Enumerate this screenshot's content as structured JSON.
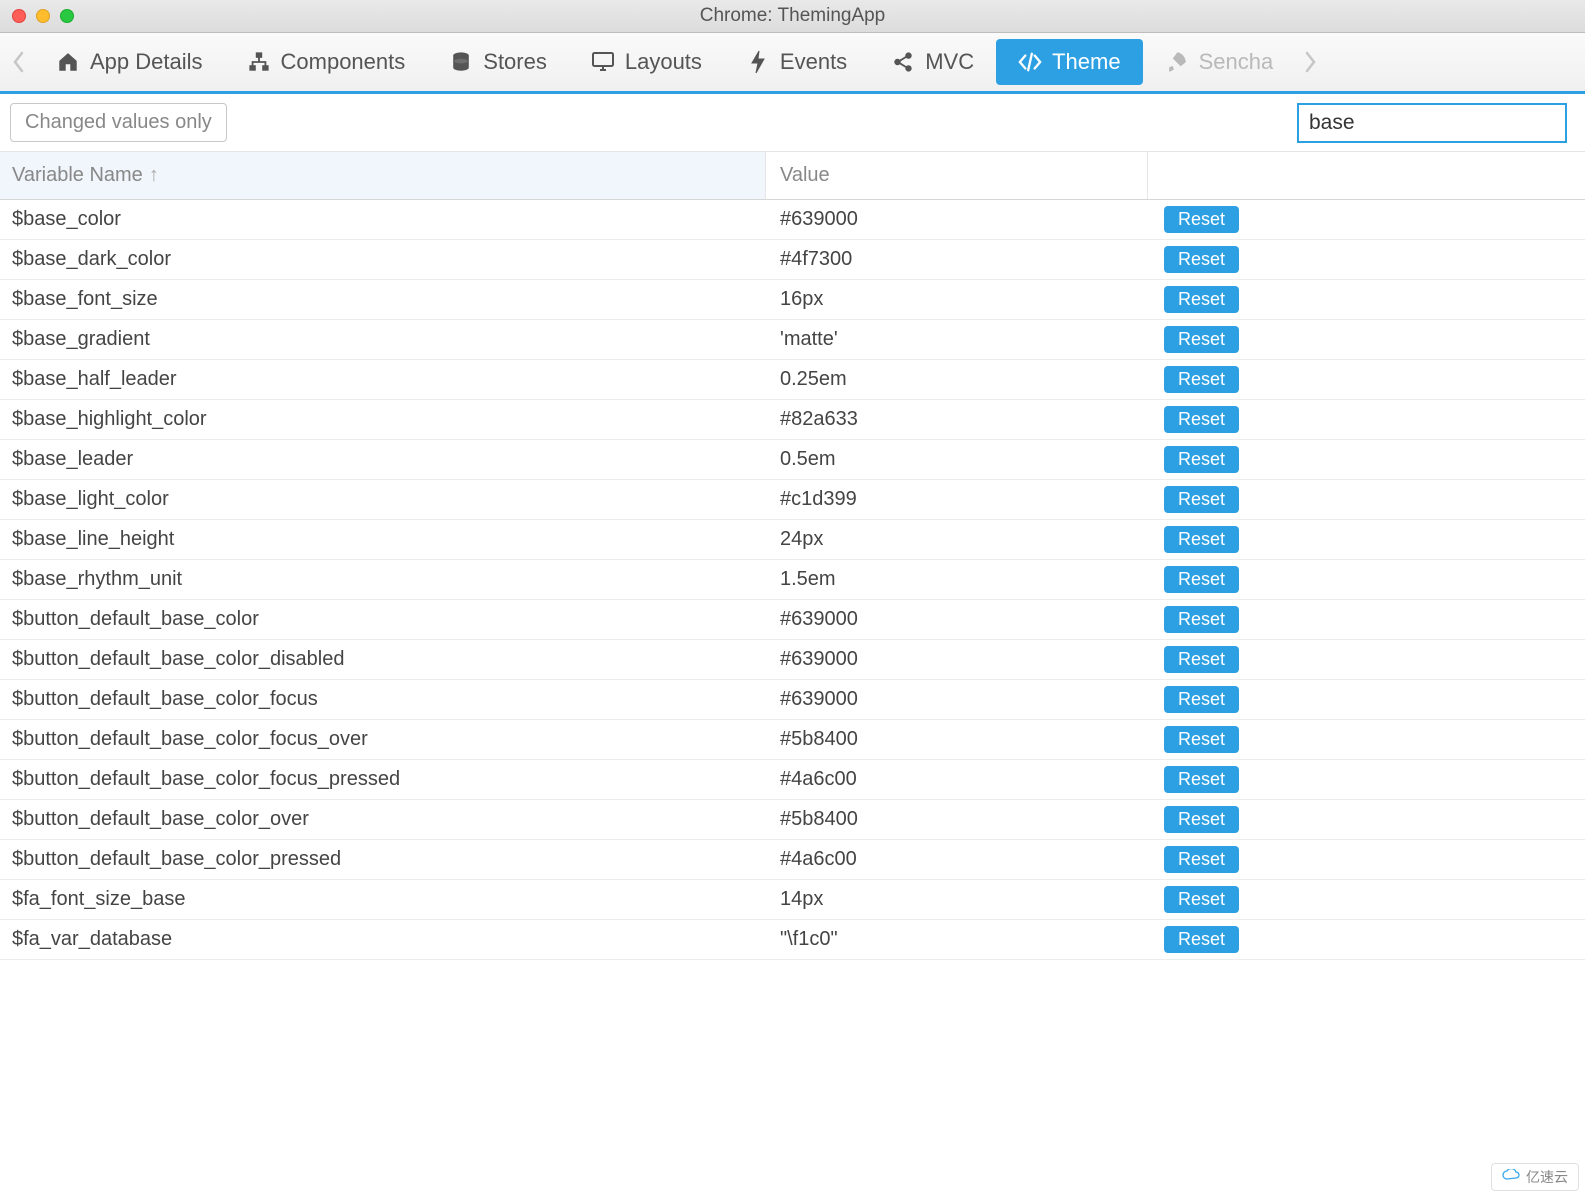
{
  "window": {
    "title": "Chrome: ThemingApp"
  },
  "nav": {
    "tabs": [
      {
        "label": "App Details",
        "icon": "home-icon"
      },
      {
        "label": "Components",
        "icon": "sitemap-icon"
      },
      {
        "label": "Stores",
        "icon": "database-icon"
      },
      {
        "label": "Layouts",
        "icon": "monitor-icon"
      },
      {
        "label": "Events",
        "icon": "bolt-icon"
      },
      {
        "label": "MVC",
        "icon": "share-icon"
      },
      {
        "label": "Theme",
        "icon": "code-icon",
        "active": true
      },
      {
        "label": "Sencha",
        "icon": "rocket-icon",
        "disabled": true
      }
    ]
  },
  "toolbar": {
    "changed_only_label": "Changed values only",
    "search_value": "base"
  },
  "columns": {
    "name": "Variable Name",
    "sort_indicator": "↑",
    "value": "Value"
  },
  "reset_label": "Reset",
  "rows": [
    {
      "name": "$base_color",
      "value": "#639000"
    },
    {
      "name": "$base_dark_color",
      "value": "#4f7300"
    },
    {
      "name": "$base_font_size",
      "value": "16px"
    },
    {
      "name": "$base_gradient",
      "value": "'matte'"
    },
    {
      "name": "$base_half_leader",
      "value": "0.25em"
    },
    {
      "name": "$base_highlight_color",
      "value": "#82a633"
    },
    {
      "name": "$base_leader",
      "value": "0.5em"
    },
    {
      "name": "$base_light_color",
      "value": "#c1d399"
    },
    {
      "name": "$base_line_height",
      "value": "24px"
    },
    {
      "name": "$base_rhythm_unit",
      "value": "1.5em"
    },
    {
      "name": "$button_default_base_color",
      "value": "#639000"
    },
    {
      "name": "$button_default_base_color_disabled",
      "value": "#639000"
    },
    {
      "name": "$button_default_base_color_focus",
      "value": "#639000"
    },
    {
      "name": "$button_default_base_color_focus_over",
      "value": "#5b8400"
    },
    {
      "name": "$button_default_base_color_focus_pressed",
      "value": "#4a6c00"
    },
    {
      "name": "$button_default_base_color_over",
      "value": "#5b8400"
    },
    {
      "name": "$button_default_base_color_pressed",
      "value": "#4a6c00"
    },
    {
      "name": "$fa_font_size_base",
      "value": "14px"
    },
    {
      "name": "$fa_var_database",
      "value": "\"\\f1c0\""
    }
  ],
  "badge": {
    "label": "亿速云"
  }
}
